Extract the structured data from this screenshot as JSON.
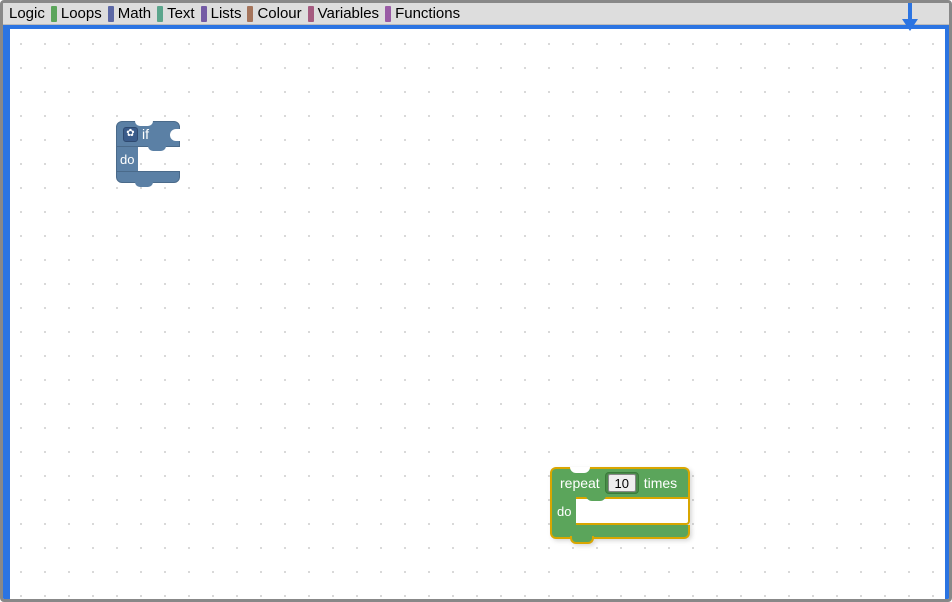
{
  "toolbox": {
    "categories": [
      {
        "label": "Logic",
        "color": "#5b80a5"
      },
      {
        "label": "Loops",
        "color": "#5ba55b"
      },
      {
        "label": "Math",
        "color": "#5b67a5"
      },
      {
        "label": "Text",
        "color": "#5ba58c"
      },
      {
        "label": "Lists",
        "color": "#745ba5"
      },
      {
        "label": "Colour",
        "color": "#a5745b"
      },
      {
        "label": "Variables",
        "color": "#a55b80"
      },
      {
        "label": "Functions",
        "color": "#995ba5"
      }
    ]
  },
  "workspace": {
    "if_block": {
      "if_label": "if",
      "do_label": "do",
      "gear": "✿"
    },
    "repeat_block": {
      "repeat_label": "repeat",
      "count": "10",
      "times_label": "times",
      "do_label": "do"
    }
  },
  "annotation": {
    "arrow_color": "#2b74e2"
  }
}
